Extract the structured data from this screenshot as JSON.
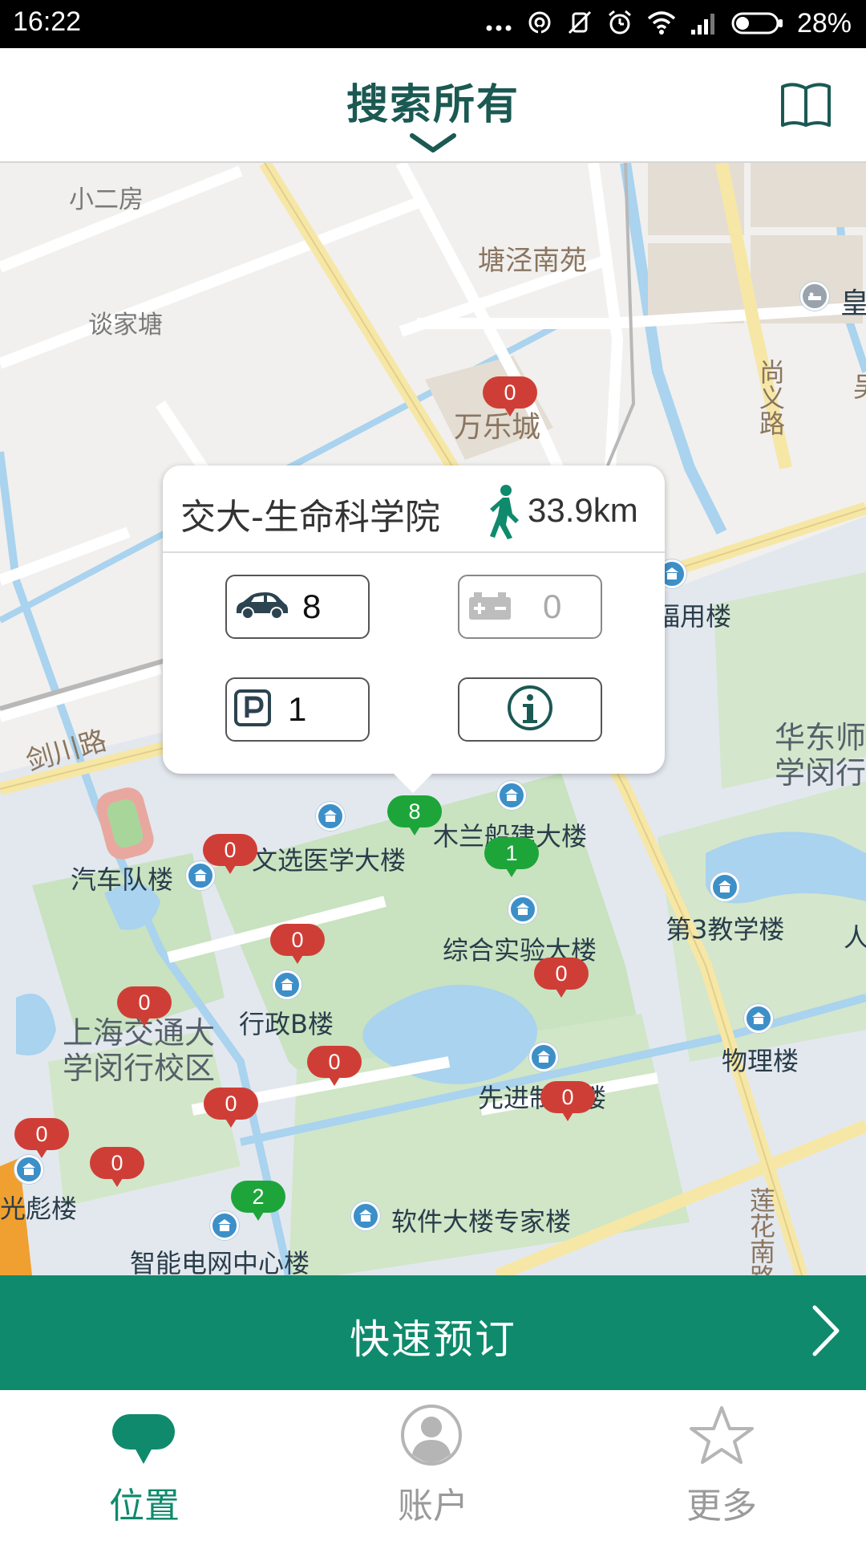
{
  "status_bar": {
    "time": "16:22",
    "battery": "28%",
    "icons": [
      "more-dots-icon",
      "hotspot-icon",
      "silent-icon",
      "alarm-icon",
      "wifi-icon",
      "signal-icon",
      "battery-icon"
    ]
  },
  "header": {
    "title": "搜索所有",
    "dropdown_icon": "chevron-down-icon",
    "book_icon": "book-icon"
  },
  "map": {
    "labels": {
      "xiaoerfang": "小二房",
      "tangjingnanyuan": "塘泾南苑",
      "huang": "皇",
      "tanjiatang": "谈家塘",
      "wanle": "万乐城",
      "shangyilu": "尚义路",
      "wu": "吴",
      "jianchuanlu": "剑川路",
      "yongloufragment": "福用楼",
      "ecnu": "华东师\n学闵行",
      "mulan": "木兰船建大楼",
      "wenxuan": "文选医学大楼",
      "qichedui": "汽车队楼",
      "disan": "第3教学楼",
      "ren": "人",
      "zonghe": "综合实验大楼",
      "xingzhengb": "行政B楼",
      "sjtu": "上海交通大\n学闵行校区",
      "wuli": "物理楼",
      "xianjin": "先进制造楼",
      "guangbiao": "光彪楼",
      "ruanjian": "软件大楼专家楼",
      "lianhua": "莲花南路",
      "zhineng": "智能电网中心楼"
    },
    "markers": [
      {
        "color": "red",
        "count": "0"
      },
      {
        "color": "green",
        "count": "8"
      },
      {
        "color": "green",
        "count": "1"
      },
      {
        "color": "red",
        "count": "0"
      },
      {
        "color": "red",
        "count": "0"
      },
      {
        "color": "red",
        "count": "0"
      },
      {
        "color": "red",
        "count": "0"
      },
      {
        "color": "red",
        "count": "0"
      },
      {
        "color": "red",
        "count": "0"
      },
      {
        "color": "red",
        "count": "0"
      },
      {
        "color": "red",
        "count": "0"
      },
      {
        "color": "red",
        "count": "0"
      },
      {
        "color": "green",
        "count": "2"
      }
    ]
  },
  "popup": {
    "station_name": "交大-生命科学院",
    "walk_icon": "walking-person-icon",
    "distance": "33.9km",
    "cars_available": "8",
    "charging_available": "0",
    "parking_available": "1",
    "info_icon": "info-icon"
  },
  "quick_book": {
    "label": "快速预订",
    "arrow_icon": "chevron-right-icon"
  },
  "bottom_nav": {
    "items": [
      {
        "label": "位置",
        "icon": "location-chat-icon",
        "active": true
      },
      {
        "label": "账户",
        "icon": "user-avatar-icon",
        "active": false
      },
      {
        "label": "更多",
        "icon": "star-icon",
        "active": false
      }
    ]
  },
  "colors": {
    "accent": "#0f8a6c",
    "title": "#1b5953",
    "marker_red": "#cf3e36",
    "marker_green": "#1ea53a",
    "poi_blue": "#3d8fc8"
  }
}
